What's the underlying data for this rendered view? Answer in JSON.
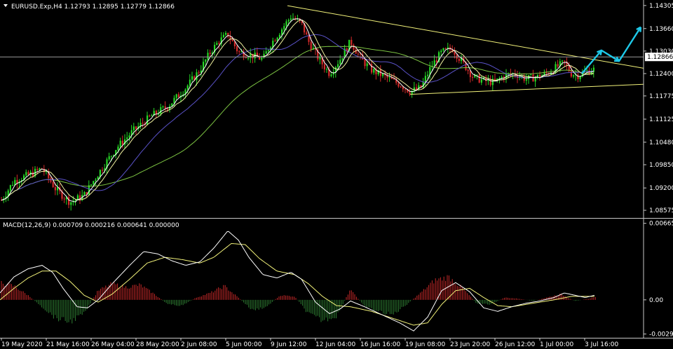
{
  "chart_data": {
    "type": "candlestick",
    "symbol_header": "EURUSD.Exp,H4  1.12793 1.12895 1.12779 1.12866",
    "current_price_label": "1.12866",
    "current_price": 1.12866,
    "price_axis": {
      "ticks": [
        "1.14305",
        "1.13660",
        "1.13030",
        "1.12400",
        "1.11775",
        "1.11125",
        "1.10480",
        "1.09850",
        "1.09200",
        "1.08575"
      ],
      "range": [
        1.0838,
        1.1442
      ]
    },
    "time_axis_labels": [
      "19 May 2020",
      "21 May 16:00",
      "26 May 04:00",
      "28 May 20:00",
      "2 Jun 08:00",
      "5 Jun 00:00",
      "9 Jun 12:00",
      "12 Jun 04:00",
      "16 Jun 16:00",
      "19 Jun 08:00",
      "23 Jun 20:00",
      "26 Jun 12:00",
      "1 Jul 00:00",
      "3 Jul 16:00"
    ],
    "price_path": [
      [
        0,
        1.088
      ],
      [
        20,
        1.094
      ],
      [
        45,
        1.096
      ],
      [
        60,
        1.0975
      ],
      [
        80,
        1.0915
      ],
      [
        100,
        1.088
      ],
      [
        120,
        1.09
      ],
      [
        140,
        1.096
      ],
      [
        165,
        1.103
      ],
      [
        190,
        1.108
      ],
      [
        215,
        1.112
      ],
      [
        240,
        1.115
      ],
      [
        265,
        1.12
      ],
      [
        285,
        1.125
      ],
      [
        300,
        1.13
      ],
      [
        312,
        1.133
      ],
      [
        325,
        1.135
      ],
      [
        340,
        1.13
      ],
      [
        360,
        1.129
      ],
      [
        375,
        1.128
      ],
      [
        385,
        1.132
      ],
      [
        400,
        1.136
      ],
      [
        415,
        1.14
      ],
      [
        430,
        1.138
      ],
      [
        440,
        1.133
      ],
      [
        455,
        1.128
      ],
      [
        470,
        1.124
      ],
      [
        485,
        1.128
      ],
      [
        500,
        1.133
      ],
      [
        515,
        1.128
      ],
      [
        530,
        1.125
      ],
      [
        550,
        1.123
      ],
      [
        570,
        1.121
      ],
      [
        585,
        1.119
      ],
      [
        600,
        1.12
      ],
      [
        615,
        1.126
      ],
      [
        630,
        1.13
      ],
      [
        645,
        1.131
      ],
      [
        660,
        1.127
      ],
      [
        675,
        1.123
      ],
      [
        690,
        1.122
      ],
      [
        705,
        1.1215
      ],
      [
        720,
        1.1235
      ],
      [
        735,
        1.124
      ],
      [
        750,
        1.1225
      ],
      [
        765,
        1.123
      ],
      [
        780,
        1.124
      ],
      [
        795,
        1.126
      ],
      [
        805,
        1.127
      ],
      [
        815,
        1.124
      ],
      [
        825,
        1.1235
      ],
      [
        835,
        1.1245
      ],
      [
        848,
        1.1252
      ]
    ],
    "overlays": [
      {
        "name": "resistance-trendline",
        "color": "#f2f27a",
        "points": [
          [
            410,
            1.143
          ],
          [
            918,
            1.1255
          ]
        ]
      },
      {
        "name": "support-trendline",
        "color": "#f2f27a",
        "points": [
          [
            585,
            1.1182
          ],
          [
            918,
            1.121
          ]
        ]
      },
      {
        "name": "current-price-line",
        "color": "#9a9a9a",
        "value": 1.12866
      },
      {
        "name": "forecast-arrow",
        "color": "#1ec8e8",
        "points": [
          [
            830,
            1.124
          ],
          [
            858,
            1.1305
          ],
          [
            883,
            1.1275
          ],
          [
            914,
            1.137
          ]
        ]
      }
    ],
    "macd": {
      "label": "MACD(12,26,9) 0.000709 0.000216 0.000641 0.000000",
      "axis_ticks": [
        "0.006655",
        "0.00",
        "-0.002973"
      ],
      "range": [
        -0.0033,
        0.007
      ],
      "hist_colors": {
        "up": "#c62828",
        "down": "#2e7d32"
      },
      "histogram": [
        [
          0,
          0.0015
        ],
        [
          20,
          0.0012
        ],
        [
          40,
          0.0004
        ],
        [
          60,
          -0.0006
        ],
        [
          80,
          -0.0016
        ],
        [
          100,
          -0.0019
        ],
        [
          120,
          -0.0012
        ],
        [
          140,
          0.0008
        ],
        [
          160,
          0.0014
        ],
        [
          180,
          0.0011
        ],
        [
          200,
          0.0013
        ],
        [
          220,
          0.0005
        ],
        [
          240,
          -0.0004
        ],
        [
          260,
          -0.0005
        ],
        [
          280,
          0.0002
        ],
        [
          300,
          0.0006
        ],
        [
          320,
          0.0012
        ],
        [
          340,
          0.0002
        ],
        [
          360,
          -0.0009
        ],
        [
          380,
          -0.0006
        ],
        [
          400,
          0.0004
        ],
        [
          420,
          0.0003
        ],
        [
          440,
          -0.0012
        ],
        [
          460,
          -0.0018
        ],
        [
          480,
          -0.0014
        ],
        [
          500,
          0.0009
        ],
        [
          520,
          -0.0006
        ],
        [
          540,
          -0.001
        ],
        [
          560,
          -0.0013
        ],
        [
          580,
          -0.0004
        ],
        [
          600,
          0.0006
        ],
        [
          620,
          0.0017
        ],
        [
          640,
          0.002
        ],
        [
          660,
          0.001
        ],
        [
          680,
          -0.0003
        ],
        [
          700,
          -0.0004
        ],
        [
          720,
          0.0002
        ],
        [
          740,
          0.0001
        ],
        [
          760,
          -0.0001
        ],
        [
          780,
          0.0002
        ],
        [
          800,
          0.0005
        ],
        [
          820,
          -0.0001
        ],
        [
          840,
          0.0001
        ],
        [
          850,
          0.0003
        ]
      ],
      "macd_line": [
        [
          0,
          0.0006
        ],
        [
          20,
          0.002
        ],
        [
          40,
          0.0027
        ],
        [
          60,
          0.003
        ],
        [
          75,
          0.0024
        ],
        [
          90,
          0.001
        ],
        [
          110,
          -0.0006
        ],
        [
          125,
          -0.0007
        ],
        [
          140,
          0.0
        ],
        [
          160,
          0.0014
        ],
        [
          185,
          0.003
        ],
        [
          205,
          0.0042
        ],
        [
          225,
          0.004
        ],
        [
          245,
          0.0034
        ],
        [
          265,
          0.003
        ],
        [
          285,
          0.0033
        ],
        [
          305,
          0.0045
        ],
        [
          325,
          0.006
        ],
        [
          340,
          0.0052
        ],
        [
          355,
          0.0037
        ],
        [
          375,
          0.0022
        ],
        [
          395,
          0.0019
        ],
        [
          415,
          0.0024
        ],
        [
          430,
          0.0018
        ],
        [
          450,
          -0.0002
        ],
        [
          470,
          -0.0012
        ],
        [
          485,
          -0.0008
        ],
        [
          500,
          -0.0001
        ],
        [
          520,
          -0.0006
        ],
        [
          545,
          -0.0013
        ],
        [
          570,
          -0.002
        ],
        [
          590,
          -0.0027
        ],
        [
          610,
          -0.0015
        ],
        [
          630,
          0.0008
        ],
        [
          650,
          0.0015
        ],
        [
          670,
          0.0007
        ],
        [
          690,
          -0.0007
        ],
        [
          710,
          -0.001
        ],
        [
          730,
          -0.0006
        ],
        [
          750,
          -0.0003
        ],
        [
          770,
          -0.0001
        ],
        [
          790,
          0.0002
        ],
        [
          805,
          0.0006
        ],
        [
          820,
          0.0004
        ],
        [
          835,
          0.0002
        ],
        [
          848,
          0.0004
        ]
      ],
      "signal_line": [
        [
          0,
          0.0
        ],
        [
          20,
          0.001
        ],
        [
          40,
          0.0019
        ],
        [
          60,
          0.0025
        ],
        [
          80,
          0.0025
        ],
        [
          100,
          0.0016
        ],
        [
          120,
          0.0004
        ],
        [
          140,
          -0.0002
        ],
        [
          160,
          0.0005
        ],
        [
          185,
          0.0018
        ],
        [
          210,
          0.0032
        ],
        [
          235,
          0.0037
        ],
        [
          260,
          0.0035
        ],
        [
          285,
          0.0032
        ],
        [
          305,
          0.0037
        ],
        [
          330,
          0.0049
        ],
        [
          350,
          0.0048
        ],
        [
          370,
          0.0036
        ],
        [
          395,
          0.0025
        ],
        [
          420,
          0.0022
        ],
        [
          440,
          0.0014
        ],
        [
          460,
          0.0003
        ],
        [
          480,
          -0.0005
        ],
        [
          500,
          -0.0006
        ],
        [
          530,
          -0.001
        ],
        [
          560,
          -0.0016
        ],
        [
          590,
          -0.0022
        ],
        [
          610,
          -0.002
        ],
        [
          630,
          -0.0004
        ],
        [
          650,
          0.0008
        ],
        [
          670,
          0.001
        ],
        [
          690,
          0.0002
        ],
        [
          710,
          -0.0005
        ],
        [
          730,
          -0.0006
        ],
        [
          760,
          -0.0003
        ],
        [
          790,
          0.0
        ],
        [
          815,
          0.0003
        ],
        [
          848,
          0.0003
        ]
      ]
    }
  }
}
